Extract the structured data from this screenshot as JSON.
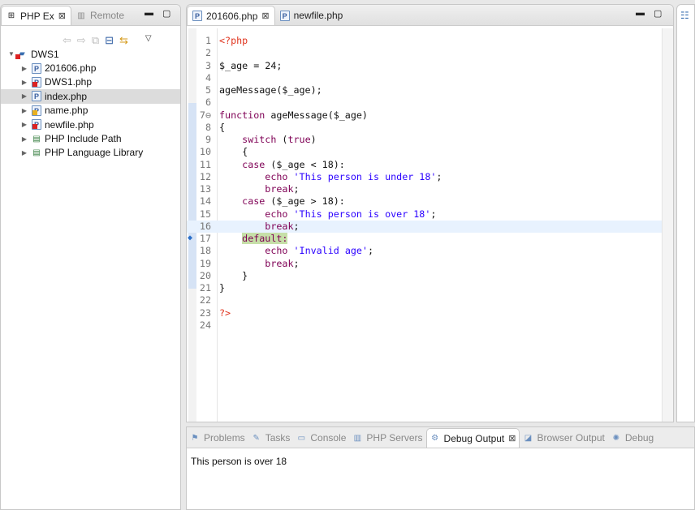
{
  "left_panel": {
    "tabs": [
      {
        "label": "PHP Ex",
        "active": true
      },
      {
        "label": "Remote",
        "active": false
      }
    ],
    "tree": {
      "root": "DWS1",
      "items": [
        {
          "label": "201606.php",
          "status": "ok"
        },
        {
          "label": "DWS1.php",
          "status": "error"
        },
        {
          "label": "index.php",
          "status": "ok",
          "selected": true
        },
        {
          "label": "name.php",
          "status": "warning"
        },
        {
          "label": "newfile.php",
          "status": "error"
        },
        {
          "label": "PHP Include Path",
          "status": "library"
        },
        {
          "label": "PHP Language Library",
          "status": "library"
        }
      ]
    }
  },
  "editor": {
    "tabs": [
      {
        "label": "201606.php",
        "active": true
      },
      {
        "label": "newfile.php",
        "active": false
      }
    ],
    "current_line": 16,
    "debug_line": 17,
    "lines": [
      [
        [
          "tag",
          "<?php"
        ]
      ],
      [],
      [
        [
          "tx",
          "$_age = 24;"
        ]
      ],
      [],
      [
        [
          "tx",
          "ageMessage($_age);"
        ]
      ],
      [],
      [
        [
          "kw",
          "function"
        ],
        [
          "tx",
          " ageMessage($_age)"
        ]
      ],
      [
        [
          "tx",
          "{"
        ]
      ],
      [
        [
          "tx",
          "    "
        ],
        [
          "kw",
          "switch"
        ],
        [
          "tx",
          " ("
        ],
        [
          "kw",
          "true"
        ],
        [
          "tx",
          ")"
        ]
      ],
      [
        [
          "tx",
          "    {"
        ]
      ],
      [
        [
          "tx",
          "    "
        ],
        [
          "kw",
          "case"
        ],
        [
          "tx",
          " ($_age < 18):"
        ]
      ],
      [
        [
          "tx",
          "        "
        ],
        [
          "kw",
          "echo"
        ],
        [
          "tx",
          " "
        ],
        [
          "str",
          "'This person is under 18'"
        ],
        [
          "tx",
          ";"
        ]
      ],
      [
        [
          "tx",
          "        "
        ],
        [
          "kw",
          "break"
        ],
        [
          "tx",
          ";"
        ]
      ],
      [
        [
          "tx",
          "    "
        ],
        [
          "kw",
          "case"
        ],
        [
          "tx",
          " ($_age > 18):"
        ]
      ],
      [
        [
          "tx",
          "        "
        ],
        [
          "kw",
          "echo"
        ],
        [
          "tx",
          " "
        ],
        [
          "str",
          "'This person is over 18'"
        ],
        [
          "tx",
          ";"
        ]
      ],
      [
        [
          "tx",
          "        "
        ],
        [
          "kw",
          "break"
        ],
        [
          "tx",
          ";"
        ]
      ],
      [
        [
          "tx",
          "    "
        ],
        [
          "kw",
          "default:"
        ]
      ],
      [
        [
          "tx",
          "        "
        ],
        [
          "kw",
          "echo"
        ],
        [
          "tx",
          " "
        ],
        [
          "str",
          "'Invalid age'"
        ],
        [
          "tx",
          ";"
        ]
      ],
      [
        [
          "tx",
          "        "
        ],
        [
          "kw",
          "break"
        ],
        [
          "tx",
          ";"
        ]
      ],
      [
        [
          "tx",
          "    }"
        ]
      ],
      [
        [
          "tx",
          "}"
        ]
      ],
      [],
      [
        [
          "tag",
          "?>"
        ]
      ],
      []
    ]
  },
  "bottom_panel": {
    "tabs": [
      {
        "label": "Problems"
      },
      {
        "label": "Tasks"
      },
      {
        "label": "Console"
      },
      {
        "label": "PHP Servers"
      },
      {
        "label": "Debug Output",
        "active": true
      },
      {
        "label": "Browser Output"
      },
      {
        "label": "Debug"
      }
    ],
    "output": "This person is over 18"
  },
  "colors": {
    "keyword": "#7f0055",
    "string": "#2a00ff",
    "php_tag": "#e0341e",
    "current_line": "#e8f2fe",
    "debug_line": "#c6dfa8"
  }
}
